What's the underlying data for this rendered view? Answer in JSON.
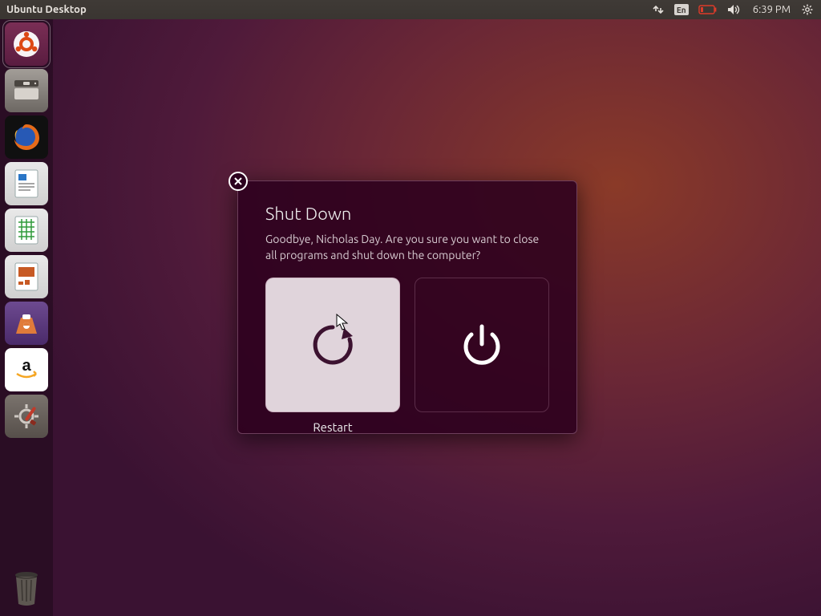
{
  "panel": {
    "title": "Ubuntu Desktop",
    "keyboard_indicator": "En",
    "clock": "6:39 PM"
  },
  "launcher": {
    "items": [
      {
        "name": "dash",
        "bg": "#6b2349"
      },
      {
        "name": "files",
        "bg": "#8f8a85"
      },
      {
        "name": "firefox",
        "bg": "#1a1a1a"
      },
      {
        "name": "writer",
        "bg": "#1f6fb3"
      },
      {
        "name": "calc",
        "bg": "#2f9a3a"
      },
      {
        "name": "impress",
        "bg": "#c75a24"
      },
      {
        "name": "software",
        "bg": "#5a3a7a"
      },
      {
        "name": "amazon",
        "bg": "#ffffff"
      },
      {
        "name": "settings",
        "bg": "#6d6561"
      }
    ]
  },
  "dialog": {
    "title": "Shut Down",
    "message": "Goodbye, Nicholas Day. Are you sure you want to close all programs and shut down the computer?",
    "restart_label": "Restart",
    "shutdown_label": ""
  }
}
